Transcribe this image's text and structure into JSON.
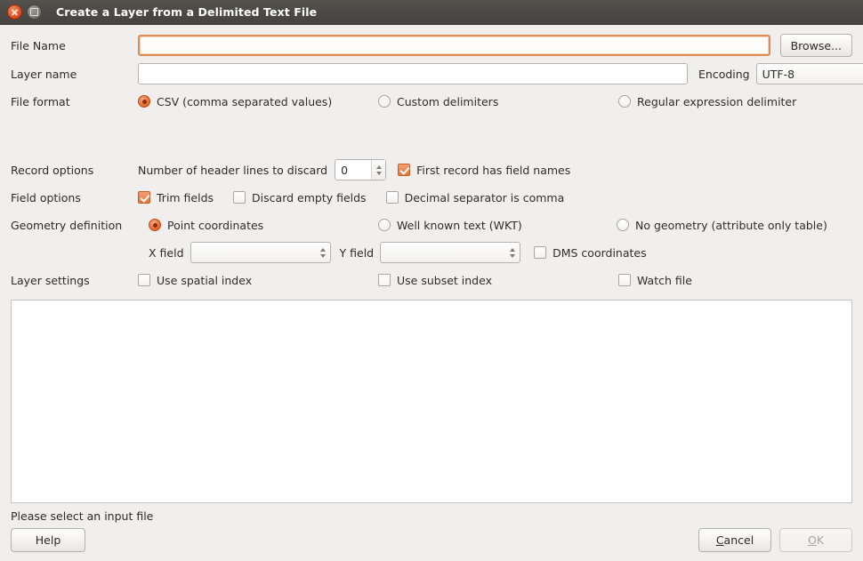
{
  "window": {
    "title": "Create a Layer from a Delimited Text File",
    "close_icon": "close-icon",
    "maximize_icon": "maximize-icon"
  },
  "colors": {
    "titlebar": "#4a4844",
    "accent": "#e8743a",
    "body_bg": "#f0efee",
    "focus_border": "#e08a55"
  },
  "file_name": {
    "label": "File Name",
    "value": "",
    "placeholder": "",
    "browse_label": "Browse..."
  },
  "layer_name": {
    "label": "Layer name",
    "value": "",
    "placeholder": ""
  },
  "encoding": {
    "label": "Encoding",
    "value": "UTF-8",
    "options": [
      "UTF-8"
    ]
  },
  "file_format": {
    "label": "File format",
    "options": [
      {
        "label": "CSV (comma separated values)",
        "checked": true
      },
      {
        "label": "Custom delimiters",
        "checked": false
      },
      {
        "label": "Regular expression delimiter",
        "checked": false
      }
    ]
  },
  "record_options": {
    "label": "Record options",
    "header_lines_label": "Number of header lines to discard",
    "header_lines_value": "0",
    "first_record_label": "First record has field names",
    "first_record_checked": true
  },
  "field_options": {
    "label": "Field options",
    "items": [
      {
        "label": "Trim fields",
        "checked": true
      },
      {
        "label": "Discard empty fields",
        "checked": false
      },
      {
        "label": "Decimal separator is comma",
        "checked": false
      }
    ]
  },
  "geometry_definition": {
    "label": "Geometry definition",
    "options": [
      {
        "label": "Point coordinates",
        "checked": true
      },
      {
        "label": "Well known text (WKT)",
        "checked": false
      },
      {
        "label": "No geometry (attribute only table)",
        "checked": false
      }
    ],
    "x_field_label": "X field",
    "x_field_value": "",
    "y_field_label": "Y field",
    "y_field_value": "",
    "dms_label": "DMS coordinates",
    "dms_checked": false
  },
  "layer_settings": {
    "label": "Layer settings",
    "items": [
      {
        "label": "Use spatial index",
        "checked": false
      },
      {
        "label": "Use subset index",
        "checked": false
      },
      {
        "label": "Watch file",
        "checked": false
      }
    ]
  },
  "preview": {
    "rows": [],
    "columns": []
  },
  "status": {
    "message": "Please select an input file"
  },
  "footer": {
    "help_label": "Help",
    "cancel_label": "Cancel",
    "cancel_mnemonic": "C",
    "ok_label": "OK",
    "ok_mnemonic": "O",
    "ok_enabled": false
  }
}
